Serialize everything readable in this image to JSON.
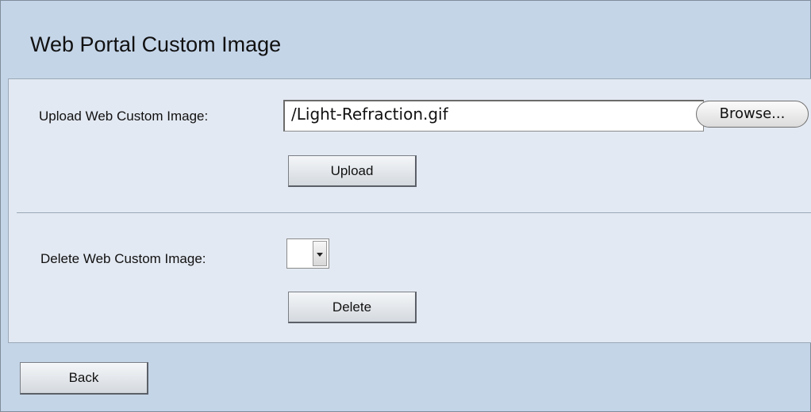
{
  "page": {
    "title": "Web Portal Custom Image"
  },
  "upload_section": {
    "label": "Upload Web Custom Image:",
    "file_value": "/Light-Refraction.gif",
    "browse_label": "Browse...",
    "upload_label": "Upload"
  },
  "delete_section": {
    "label": "Delete Web Custom Image:",
    "selected_value": "",
    "delete_label": "Delete"
  },
  "footer": {
    "back_label": "Back"
  },
  "colors": {
    "page_background": "#c5d5e8",
    "panel_background": "#e3e9f2"
  }
}
